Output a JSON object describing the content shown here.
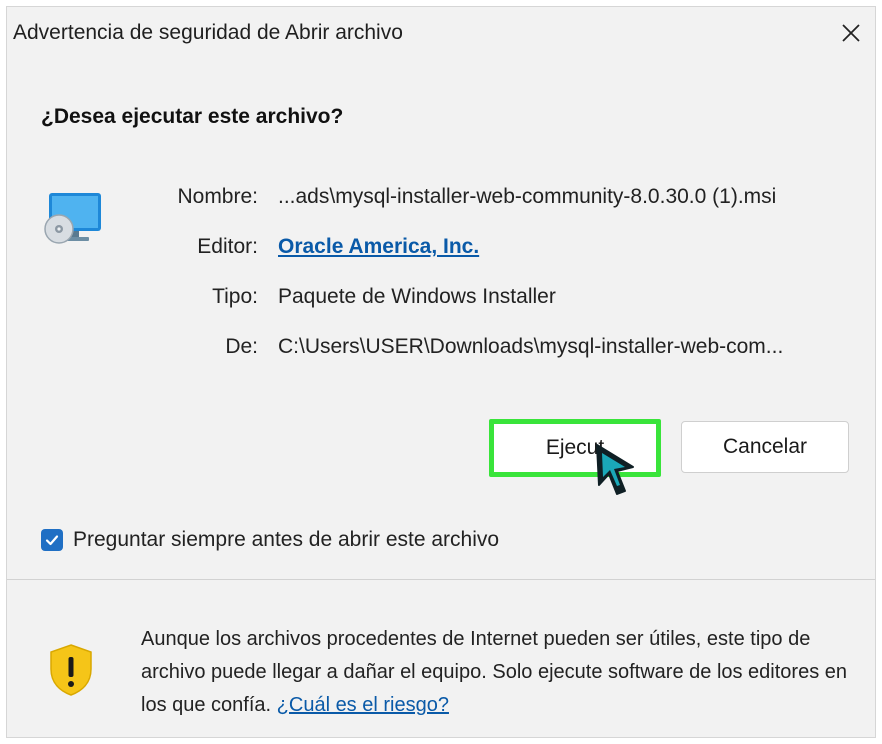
{
  "window": {
    "title": "Advertencia de seguridad de Abrir archivo"
  },
  "question": "¿Desea ejecutar este archivo?",
  "file_info": {
    "name_label": "Nombre:",
    "name_value": "...ads\\mysql-installer-web-community-8.0.30.0 (1).msi",
    "publisher_label": "Editor:",
    "publisher_value": "Oracle America, Inc.",
    "type_label": "Tipo:",
    "type_value": "Paquete de Windows Installer",
    "from_label": "De:",
    "from_value": "C:\\Users\\USER\\Downloads\\mysql-installer-web-com..."
  },
  "buttons": {
    "run_label": "Ejecut",
    "cancel_label": "Cancelar"
  },
  "checkbox": {
    "label": "Preguntar siempre antes de abrir este archivo",
    "checked": true
  },
  "warning": {
    "text": "Aunque los archivos procedentes de Internet pueden ser útiles, este tipo de archivo puede llegar a dañar el equipo. Solo ejecute software de los editores en los que confía. ",
    "link_label": "¿Cuál es el riesgo?"
  },
  "icons": {
    "file": "installer-package-icon",
    "close": "close-icon",
    "warning": "shield-warning-icon",
    "check": "checkmark-icon",
    "cursor": "mouse-cursor-icon"
  },
  "colors": {
    "link": "#0a5aa8",
    "checkbox": "#1f6fc4",
    "highlight": "#39e43a",
    "shield": "#f5c518"
  }
}
